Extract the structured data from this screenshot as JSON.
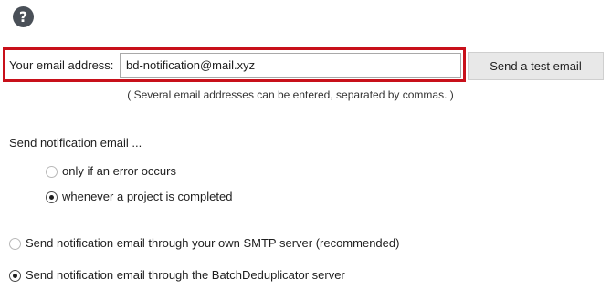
{
  "help": {
    "icon": "question-circle-icon",
    "glyph": "?"
  },
  "email": {
    "label": "Your email address:",
    "value": "bd-notification@mail.xyz",
    "hint": "( Several email addresses can be entered, separated by commas. )",
    "highlight_color": "#c8101a"
  },
  "test_button": {
    "label": "Send a test email"
  },
  "notify": {
    "heading": "Send notification email ...",
    "options": [
      {
        "label": "only if an error occurs",
        "checked": false
      },
      {
        "label": "whenever a project is completed",
        "checked": true
      }
    ]
  },
  "server": {
    "options": [
      {
        "label": "Send notification email through your own SMTP server (recommended)",
        "checked": false
      },
      {
        "label": "Send notification email through the BatchDeduplicator server",
        "checked": true
      }
    ]
  }
}
